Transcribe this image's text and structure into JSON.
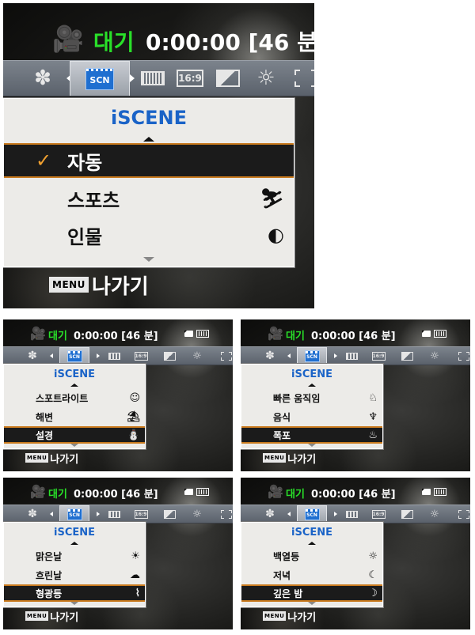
{
  "status": {
    "camera_icon": "video-camera-icon",
    "mode_label": "대기",
    "time_remaining": "0:00:00",
    "duration_bracket": "[46 분]",
    "storage_icon": "memory-card-icon",
    "battery_icon": "battery-icon"
  },
  "tabs": {
    "settings_glyph": "✽",
    "scn_label": "SCN",
    "ratio_label": "16:9",
    "focus_glyph": "⊡"
  },
  "menu": {
    "title": "iSCENE",
    "check": "✓",
    "exit_key": "MENU",
    "exit_label": "나가기"
  },
  "screens": [
    {
      "rows": [
        {
          "label": "자동",
          "icon": "",
          "selected": true,
          "checked": true
        },
        {
          "label": "스포츠",
          "icon": "⛷",
          "selected": false
        },
        {
          "label": "인물",
          "icon": "◐",
          "selected": false
        }
      ]
    },
    {
      "rows": [
        {
          "label": "스포트라이트",
          "icon": "☺",
          "selected": false
        },
        {
          "label": "해변",
          "icon": "⛱",
          "selected": false
        },
        {
          "label": "설경",
          "icon": "⛄",
          "selected": true
        }
      ]
    },
    {
      "rows": [
        {
          "label": "빠른 움직임",
          "icon": "♘",
          "selected": false
        },
        {
          "label": "음식",
          "icon": "♆",
          "selected": false
        },
        {
          "label": "폭포",
          "icon": "♨",
          "selected": true
        }
      ]
    },
    {
      "rows": [
        {
          "label": "맑은날",
          "icon": "☀",
          "selected": false
        },
        {
          "label": "흐린날",
          "icon": "☁",
          "selected": false
        },
        {
          "label": "형광등",
          "icon": "⌇",
          "selected": true
        }
      ]
    },
    {
      "rows": [
        {
          "label": "백열등",
          "icon": "☼",
          "selected": false
        },
        {
          "label": "저녁",
          "icon": "☾",
          "selected": false
        },
        {
          "label": "깊은 밤",
          "icon": "☽",
          "selected": true
        }
      ]
    }
  ],
  "colors": {
    "mode_green": "#29e029",
    "title_blue": "#1a63c7",
    "selection_border": "#c97a1e",
    "check_orange": "#f0a030"
  }
}
